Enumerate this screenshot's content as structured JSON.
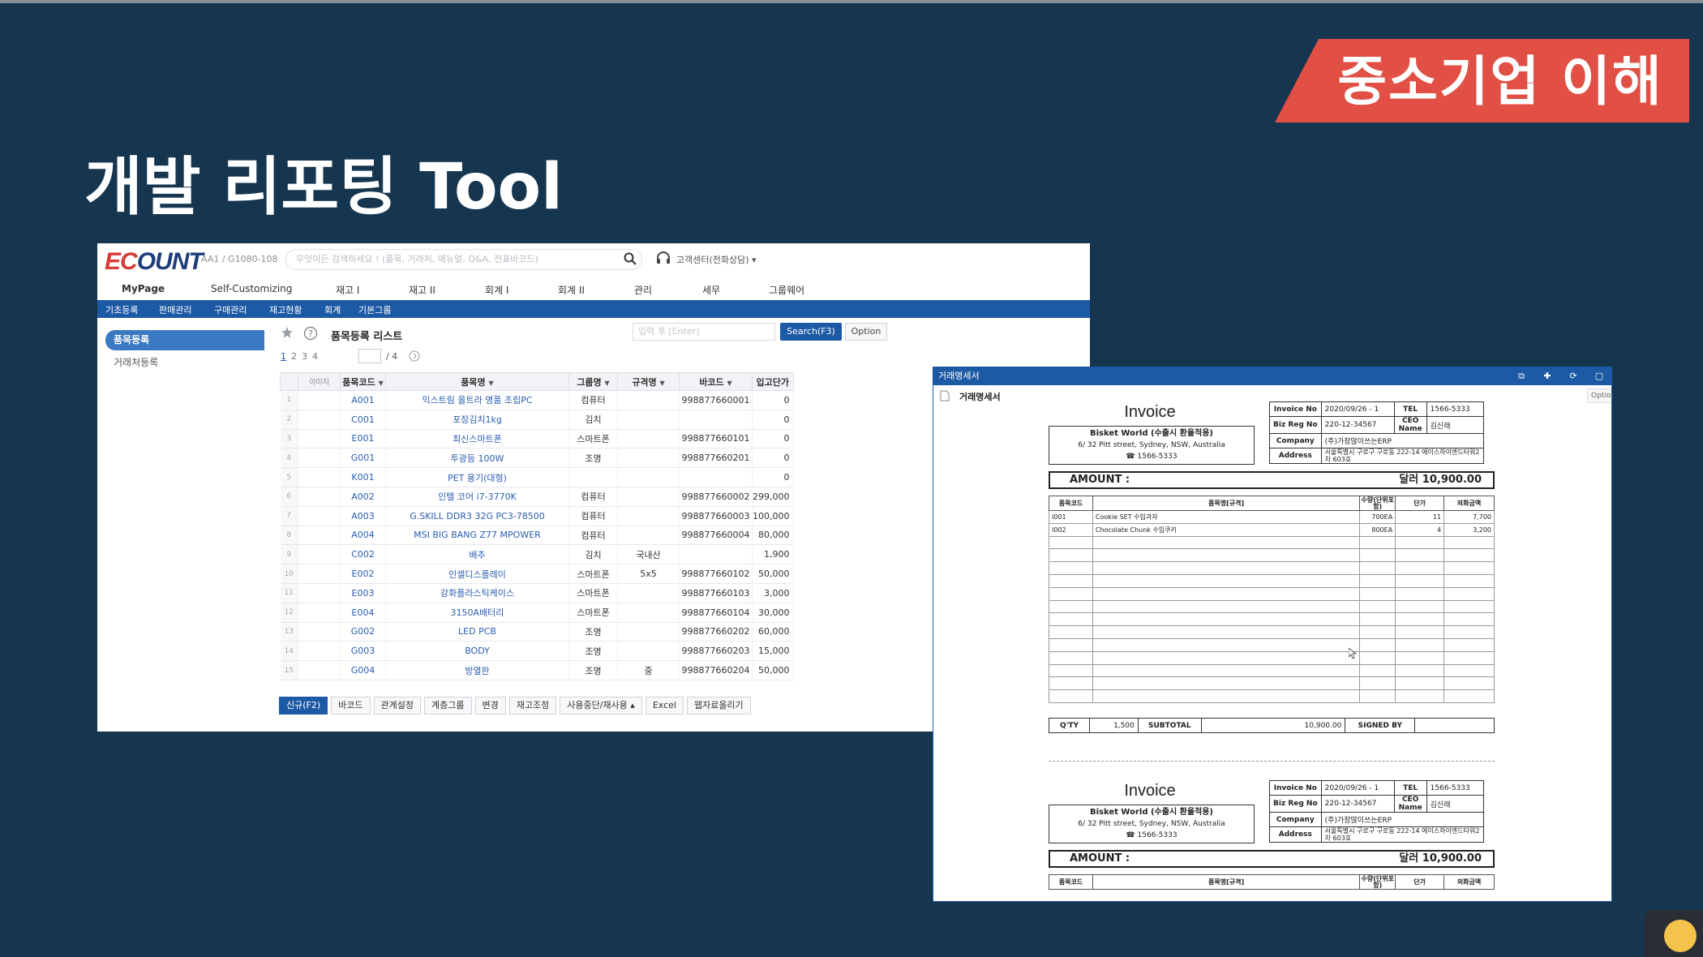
{
  "slide": {
    "banner": "중소기업 이해",
    "title": "개발 리포팅 Tool"
  },
  "app": {
    "logo": {
      "first": "EC",
      "rest": "OUNT"
    },
    "company_code": "AA1 / G1080-108",
    "search_placeholder": "무엇이든 검색하세요 ! (품목, 거래처, 메뉴얼, Q&A, 전표바코드)",
    "support": "고객센터(전화상담) ▾",
    "main_nav": [
      "MyPage",
      "Self-Customizing",
      "재고 I",
      "재고 II",
      "회계 I",
      "회계 II",
      "관리",
      "세무",
      "그룹웨어"
    ],
    "sub_nav": [
      "기초등록",
      "판매관리",
      "구매관리",
      "재고현황",
      "회계",
      "기본그룹"
    ],
    "sidebar": [
      "품목등록",
      "거래처등록"
    ],
    "list_title": "품목등록 리스트",
    "quick_search_placeholder": "입력 후 [Enter]",
    "search_button": "Search(F3)",
    "option_button": "Option",
    "pages": [
      "1",
      "2",
      "3",
      "4"
    ],
    "page_total": "/ 4",
    "columns": [
      "",
      "이미지",
      "품목코드",
      "품목명",
      "그룹명",
      "규격명",
      "바코드",
      "입고단가"
    ],
    "rows": [
      {
        "n": "1",
        "code": "A001",
        "name": "익스트림 올트라 명품 조립PC",
        "group": "컴퓨터",
        "spec": "",
        "barcode": "998877660001",
        "price": "0"
      },
      {
        "n": "2",
        "code": "C001",
        "name": "포장김치1kg",
        "group": "김치",
        "spec": "",
        "barcode": "",
        "price": "0"
      },
      {
        "n": "3",
        "code": "E001",
        "name": "최신스마트폰",
        "group": "스마트폰",
        "spec": "",
        "barcode": "998877660101",
        "price": "0"
      },
      {
        "n": "4",
        "code": "G001",
        "name": "투광등 100W",
        "group": "조명",
        "spec": "",
        "barcode": "998877660201",
        "price": "0"
      },
      {
        "n": "5",
        "code": "K001",
        "name": "PET 용기(대형)",
        "group": "",
        "spec": "",
        "barcode": "",
        "price": "0"
      },
      {
        "n": "6",
        "code": "A002",
        "name": "인텔 코어 i7-3770K",
        "group": "컴퓨터",
        "spec": "",
        "barcode": "998877660002",
        "price": "299,000"
      },
      {
        "n": "7",
        "code": "A003",
        "name": "G.SKILL DDR3 32G PC3-78500",
        "group": "컴퓨터",
        "spec": "",
        "barcode": "998877660003",
        "price": "100,000"
      },
      {
        "n": "8",
        "code": "A004",
        "name": "MSI BIG BANG Z77 MPOWER",
        "group": "컴퓨터",
        "spec": "",
        "barcode": "998877660004",
        "price": "80,000"
      },
      {
        "n": "9",
        "code": "C002",
        "name": "배추",
        "group": "김치",
        "spec": "국내산",
        "barcode": "",
        "price": "1,900"
      },
      {
        "n": "10",
        "code": "E002",
        "name": "인셀디스플레이",
        "group": "스마트폰",
        "spec": "5x5",
        "barcode": "998877660102",
        "price": "50,000"
      },
      {
        "n": "11",
        "code": "E003",
        "name": "강화플라스틱케이스",
        "group": "스마트폰",
        "spec": "",
        "barcode": "998877660103",
        "price": "3,000"
      },
      {
        "n": "12",
        "code": "E004",
        "name": "3150A배터리",
        "group": "스마트폰",
        "spec": "",
        "barcode": "998877660104",
        "price": "30,000"
      },
      {
        "n": "13",
        "code": "G002",
        "name": "LED PCB",
        "group": "조명",
        "spec": "",
        "barcode": "998877660202",
        "price": "60,000"
      },
      {
        "n": "14",
        "code": "G003",
        "name": "BODY",
        "group": "조명",
        "spec": "",
        "barcode": "998877660203",
        "price": "15,000"
      },
      {
        "n": "15",
        "code": "G004",
        "name": "방열판",
        "group": "조명",
        "spec": "중",
        "barcode": "998877660204",
        "price": "50,000"
      }
    ],
    "bottom_buttons": [
      "신규(F2)",
      "바코드",
      "관계설정",
      "계층그룹",
      "변경",
      "재고조정",
      "사용중단/재사용 ▴",
      "Excel",
      "웹자료올리기"
    ]
  },
  "popup": {
    "title": "거래명세서",
    "sub_title": "거래명세서",
    "option": "Option",
    "controls": [
      "⧉",
      "✚",
      "⟳",
      "▢",
      "✕"
    ],
    "invoice": {
      "title": "Invoice",
      "seller_name": "Bisket World (수출시 환율적용)",
      "seller_addr": "6/ 32 Pitt street, Sydney, NSW, Australia",
      "seller_tel": "☎ 1566-5333",
      "invoice_no_label": "Invoice No",
      "invoice_no": "2020/09/26 - 1",
      "tel_label": "TEL",
      "tel": "1566-5333",
      "biz_label": "Biz Reg No",
      "biz": "220-12-34567",
      "ceo_label": "CEO Name",
      "ceo": "김신래",
      "company_label": "Company",
      "company": "(주)가장많이쓰는ERP",
      "address_label": "Address",
      "address": "서울특별시 구로구 구로동 222-14 에이스하이엔드타워2차 603호",
      "amount_label": "AMOUNT :",
      "amount_value": "달러 10,900.00",
      "item_headers": [
        "품목코드",
        "품목명[규격]",
        "수량(단위포함)",
        "단가",
        "외화금액"
      ],
      "items": [
        {
          "code": "I001",
          "name": "Cookie SET 수입과자",
          "qty": "700EA",
          "price": "11",
          "amount": "7,700"
        },
        {
          "code": "I002",
          "name": "Chocolate Chunk 수입쿠키",
          "qty": "800EA",
          "price": "4",
          "amount": "3,200"
        }
      ],
      "qty_label": "Q'TY",
      "qty_value": "1,500",
      "subtotal_label": "SUBTOTAL",
      "subtotal_value": "10,900.00",
      "signed_label": "SIGNED BY"
    }
  }
}
